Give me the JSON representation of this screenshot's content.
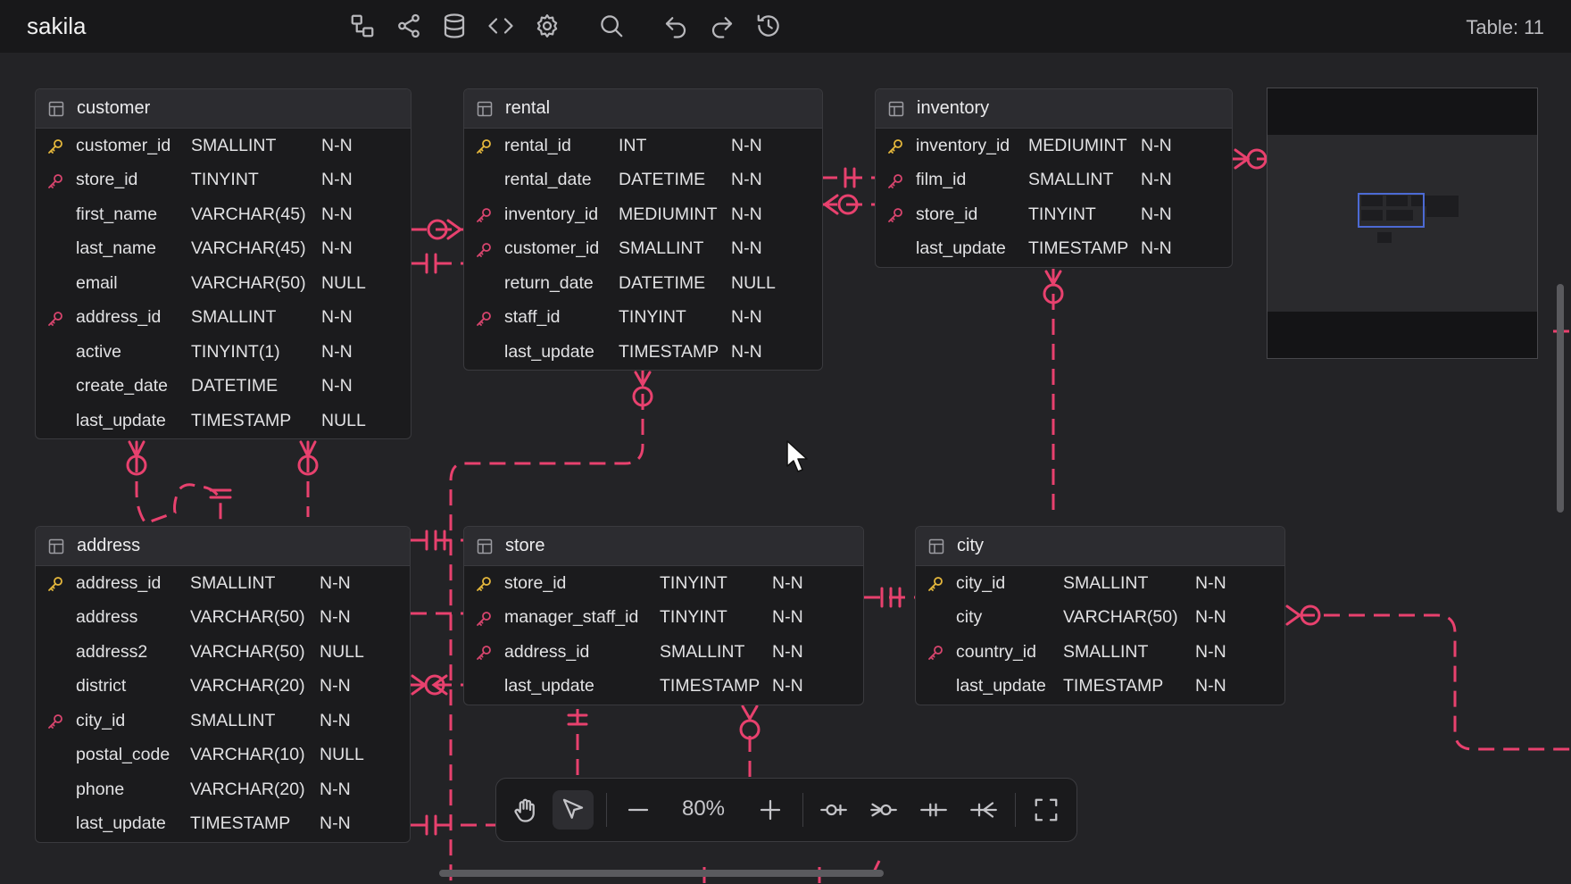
{
  "app": {
    "title": "sakila",
    "table_count": "Table: 11"
  },
  "toolbar_top": {
    "icons": [
      "diagram-icon",
      "share-icon",
      "database-icon",
      "code-icon",
      "settings-icon",
      "search-icon",
      "undo-icon",
      "redo-icon",
      "history-icon"
    ]
  },
  "tables": {
    "customer": {
      "name": "customer",
      "columns": [
        {
          "name": "customer_id",
          "type": "SMALLINT",
          "null": "N-N",
          "key": "pk"
        },
        {
          "name": "store_id",
          "type": "TINYINT",
          "null": "N-N",
          "key": "fk"
        },
        {
          "name": "first_name",
          "type": "VARCHAR(45)",
          "null": "N-N",
          "key": ""
        },
        {
          "name": "last_name",
          "type": "VARCHAR(45)",
          "null": "N-N",
          "key": ""
        },
        {
          "name": "email",
          "type": "VARCHAR(50)",
          "null": "NULL",
          "key": ""
        },
        {
          "name": "address_id",
          "type": "SMALLINT",
          "null": "N-N",
          "key": "fk"
        },
        {
          "name": "active",
          "type": "TINYINT(1)",
          "null": "N-N",
          "key": ""
        },
        {
          "name": "create_date",
          "type": "DATETIME",
          "null": "N-N",
          "key": ""
        },
        {
          "name": "last_update",
          "type": "TIMESTAMP",
          "null": "NULL",
          "key": ""
        }
      ]
    },
    "rental": {
      "name": "rental",
      "columns": [
        {
          "name": "rental_id",
          "type": "INT",
          "null": "N-N",
          "key": "pk"
        },
        {
          "name": "rental_date",
          "type": "DATETIME",
          "null": "N-N",
          "key": ""
        },
        {
          "name": "inventory_id",
          "type": "MEDIUMINT",
          "null": "N-N",
          "key": "fk"
        },
        {
          "name": "customer_id",
          "type": "SMALLINT",
          "null": "N-N",
          "key": "fk"
        },
        {
          "name": "return_date",
          "type": "DATETIME",
          "null": "NULL",
          "key": ""
        },
        {
          "name": "staff_id",
          "type": "TINYINT",
          "null": "N-N",
          "key": "fk"
        },
        {
          "name": "last_update",
          "type": "TIMESTAMP",
          "null": "N-N",
          "key": ""
        }
      ]
    },
    "inventory": {
      "name": "inventory",
      "columns": [
        {
          "name": "inventory_id",
          "type": "MEDIUMINT",
          "null": "N-N",
          "key": "pk"
        },
        {
          "name": "film_id",
          "type": "SMALLINT",
          "null": "N-N",
          "key": "fk"
        },
        {
          "name": "store_id",
          "type": "TINYINT",
          "null": "N-N",
          "key": "fk"
        },
        {
          "name": "last_update",
          "type": "TIMESTAMP",
          "null": "N-N",
          "key": ""
        }
      ]
    },
    "address": {
      "name": "address",
      "columns": [
        {
          "name": "address_id",
          "type": "SMALLINT",
          "null": "N-N",
          "key": "pk"
        },
        {
          "name": "address",
          "type": "VARCHAR(50)",
          "null": "N-N",
          "key": ""
        },
        {
          "name": "address2",
          "type": "VARCHAR(50)",
          "null": "NULL",
          "key": ""
        },
        {
          "name": "district",
          "type": "VARCHAR(20)",
          "null": "N-N",
          "key": ""
        },
        {
          "name": "city_id",
          "type": "SMALLINT",
          "null": "N-N",
          "key": "fk"
        },
        {
          "name": "postal_code",
          "type": "VARCHAR(10)",
          "null": "NULL",
          "key": ""
        },
        {
          "name": "phone",
          "type": "VARCHAR(20)",
          "null": "N-N",
          "key": ""
        },
        {
          "name": "last_update",
          "type": "TIMESTAMP",
          "null": "N-N",
          "key": ""
        }
      ]
    },
    "store": {
      "name": "store",
      "columns": [
        {
          "name": "store_id",
          "type": "TINYINT",
          "null": "N-N",
          "key": "pk"
        },
        {
          "name": "manager_staff_id",
          "type": "TINYINT",
          "null": "N-N",
          "key": "fk"
        },
        {
          "name": "address_id",
          "type": "SMALLINT",
          "null": "N-N",
          "key": "fk"
        },
        {
          "name": "last_update",
          "type": "TIMESTAMP",
          "null": "N-N",
          "key": ""
        }
      ]
    },
    "city": {
      "name": "city",
      "columns": [
        {
          "name": "city_id",
          "type": "SMALLINT",
          "null": "N-N",
          "key": "pk"
        },
        {
          "name": "city",
          "type": "VARCHAR(50)",
          "null": "N-N",
          "key": ""
        },
        {
          "name": "country_id",
          "type": "SMALLINT",
          "null": "N-N",
          "key": "fk"
        },
        {
          "name": "last_update",
          "type": "TIMESTAMP",
          "null": "N-N",
          "key": ""
        }
      ]
    }
  },
  "zoom": {
    "level": "80%"
  },
  "colors": {
    "relation": "#e8416e",
    "pk_key": "#e6b83c",
    "fk_key": "#d9456e",
    "accent": "#4c6ad4"
  }
}
